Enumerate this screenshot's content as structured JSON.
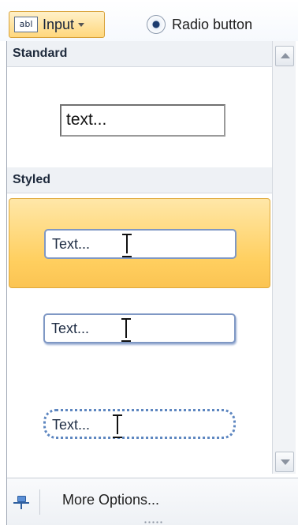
{
  "ribbon": {
    "input_button": {
      "icon_text": "abl",
      "label": "Input"
    },
    "radio_button": {
      "label": "Radio button"
    }
  },
  "gallery": {
    "standard": {
      "header": "Standard",
      "sample_text": "text..."
    },
    "styled": {
      "header": "Styled",
      "items": [
        {
          "text": "Text...",
          "style": "flat",
          "selected": true
        },
        {
          "text": "Text...",
          "style": "shadow",
          "selected": false
        },
        {
          "text": "Text...",
          "style": "dotted",
          "selected": false
        }
      ]
    }
  },
  "footer": {
    "more_options": "More Options..."
  },
  "colors": {
    "selected_highlight": "#ffcf5f",
    "input_border": "#7f98c4"
  }
}
